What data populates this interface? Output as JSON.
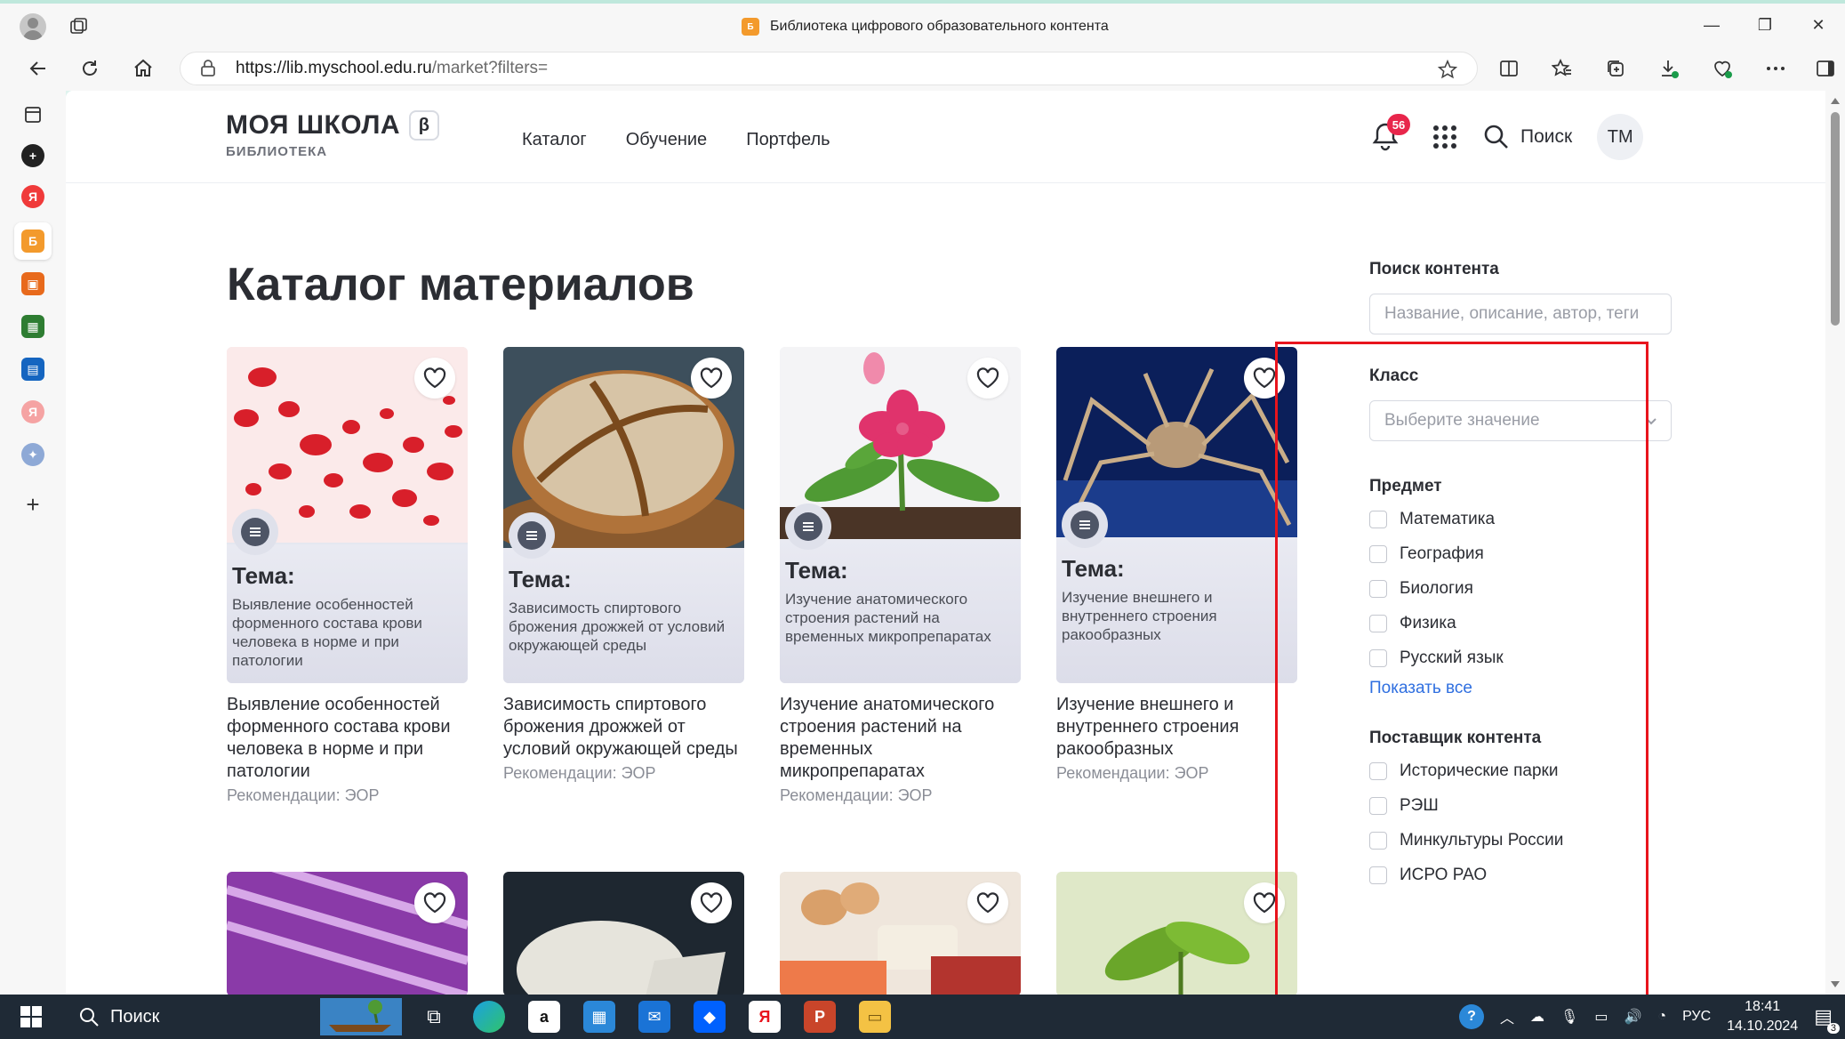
{
  "browser": {
    "tab_title": "Библиотека цифрового образовательного контента",
    "url_host": "https://lib.myschool.edu.ru",
    "url_path": "/market?filters="
  },
  "site": {
    "logo_main": "МОЯ ШКОЛА",
    "logo_beta": "β",
    "logo_sub": "БИБЛИОТЕКА",
    "menu": [
      "Каталог",
      "Обучение",
      "Портфель"
    ],
    "notifications_count": "56",
    "search_label": "Поиск",
    "avatar_initials": "ТМ"
  },
  "page_title": "Каталог материалов",
  "cards": [
    {
      "theme": "Тема:",
      "desc": "Выявление особенностей форменного состава крови человека в норме и при патологии",
      "title": "Выявление особенностей форменного состава крови человека в норме и при патологии",
      "rec": "Рекомендации: ЭОР"
    },
    {
      "theme": "Тема:",
      "desc": "Зависимость спиртового брожения дрожжей от условий окружающей среды",
      "title": "Зависимость спиртового брожения дрожжей от условий окружающей среды",
      "rec": "Рекомендации: ЭОР"
    },
    {
      "theme": "Тема:",
      "desc": "Изучение анатомического строения растений на временных микропрепаратах",
      "title": "Изучение анатомического строения растений на временных микропрепаратах",
      "rec": "Рекомендации: ЭОР"
    },
    {
      "theme": "Тема:",
      "desc": "Изучение внешнего и внутреннего строения ракообразных",
      "title": "Изучение внешнего и внутреннего строения ракообразных",
      "rec": "Рекомендации: ЭОР"
    }
  ],
  "filters": {
    "search_label": "Поиск контента",
    "search_placeholder": "Название, описание, автор, теги",
    "class_label": "Класс",
    "class_placeholder": "Выберите значение",
    "subject_label": "Предмет",
    "subjects": [
      "Математика",
      "География",
      "Биология",
      "Физика",
      "Русский язык"
    ],
    "show_all": "Показать все",
    "provider_label": "Поставщик контента",
    "providers": [
      "Исторические парки",
      "РЭШ",
      "Минкультуры России",
      "ИСРО РАО"
    ]
  },
  "taskbar": {
    "search_label": "Поиск",
    "lang": "РУС",
    "time": "18:41",
    "date": "14.10.2024",
    "notif_count": "3"
  },
  "colors": {
    "accent_link": "#2f6fe0",
    "badge": "#e8264b",
    "highlight_frame": "#e8141d"
  }
}
